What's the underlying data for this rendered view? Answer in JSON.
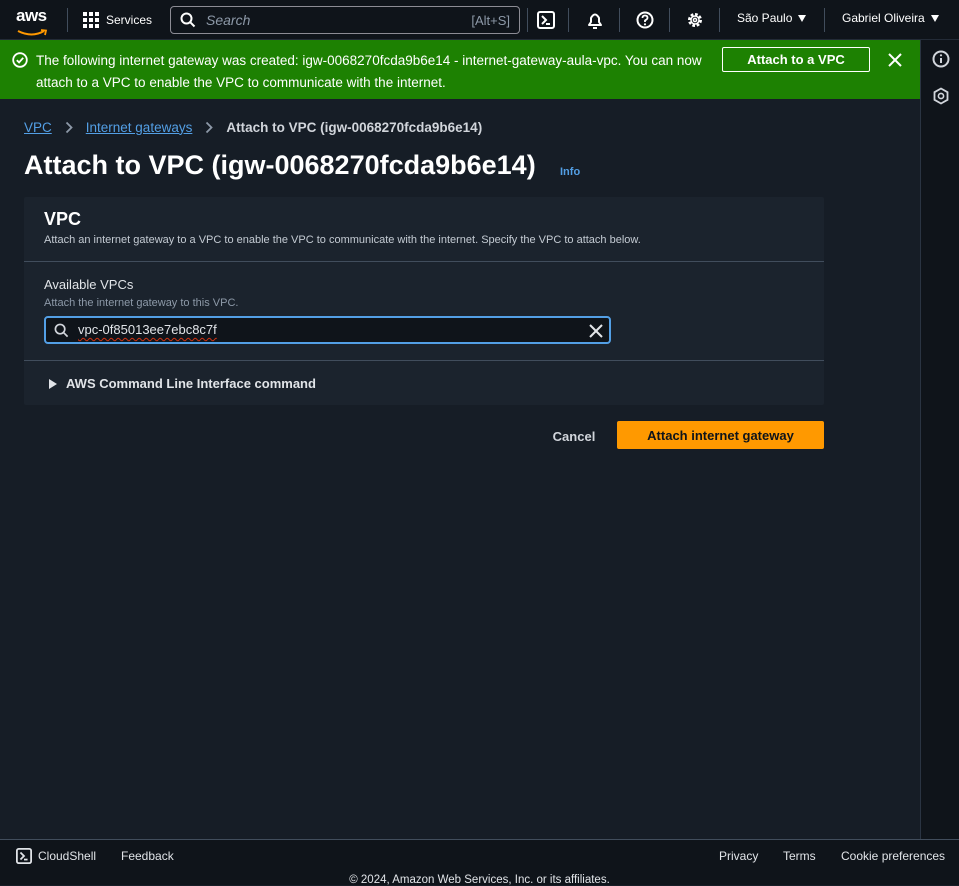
{
  "topnav": {
    "logo_text": "aws",
    "services_label": "Services",
    "search_placeholder": "Search",
    "search_shortcut": "[Alt+S]",
    "region": "São Paulo",
    "user": "Gabriel Oliveira",
    "icons": [
      "cloudshell-icon",
      "notifications-icon",
      "help-icon",
      "settings-icon"
    ]
  },
  "flash": {
    "type": "success",
    "message": "The following internet gateway was created: igw-0068270fcda9b6e14 - internet-gateway-aula-vpc. You can now attach to a VPC to enable the VPC to communicate with the internet.",
    "action_label": "Attach to a VPC",
    "color": "#1d8102"
  },
  "breadcrumb": [
    {
      "label": "VPC",
      "link": true
    },
    {
      "label": "Internet gateways",
      "link": true
    },
    {
      "label": "Attach to VPC (igw-0068270fcda9b6e14)",
      "link": false
    }
  ],
  "page": {
    "title": "Attach to VPC (igw-0068270fcda9b6e14)",
    "info_label": "Info"
  },
  "panel": {
    "title": "VPC",
    "description": "Attach an internet gateway to a VPC to enable the VPC to communicate with the internet. Specify the VPC to attach below.",
    "field_label": "Available VPCs",
    "field_description": "Attach the internet gateway to this VPC.",
    "field_value": "vpc-0f85013ee7ebc8c7f",
    "cli_toggle_label": "AWS Command Line Interface command"
  },
  "actions": {
    "cancel_label": "Cancel",
    "primary_label": "Attach internet gateway",
    "primary_color": "#ff9900"
  },
  "footer": {
    "cloudshell_label": "CloudShell",
    "feedback_label": "Feedback",
    "privacy_label": "Privacy",
    "terms_label": "Terms",
    "cookies_label": "Cookie preferences",
    "copyright": "© 2024, Amazon Web Services, Inc. or its affiliates."
  },
  "colors": {
    "background": "#161d26",
    "link": "#539fe5",
    "success": "#1d8102"
  }
}
